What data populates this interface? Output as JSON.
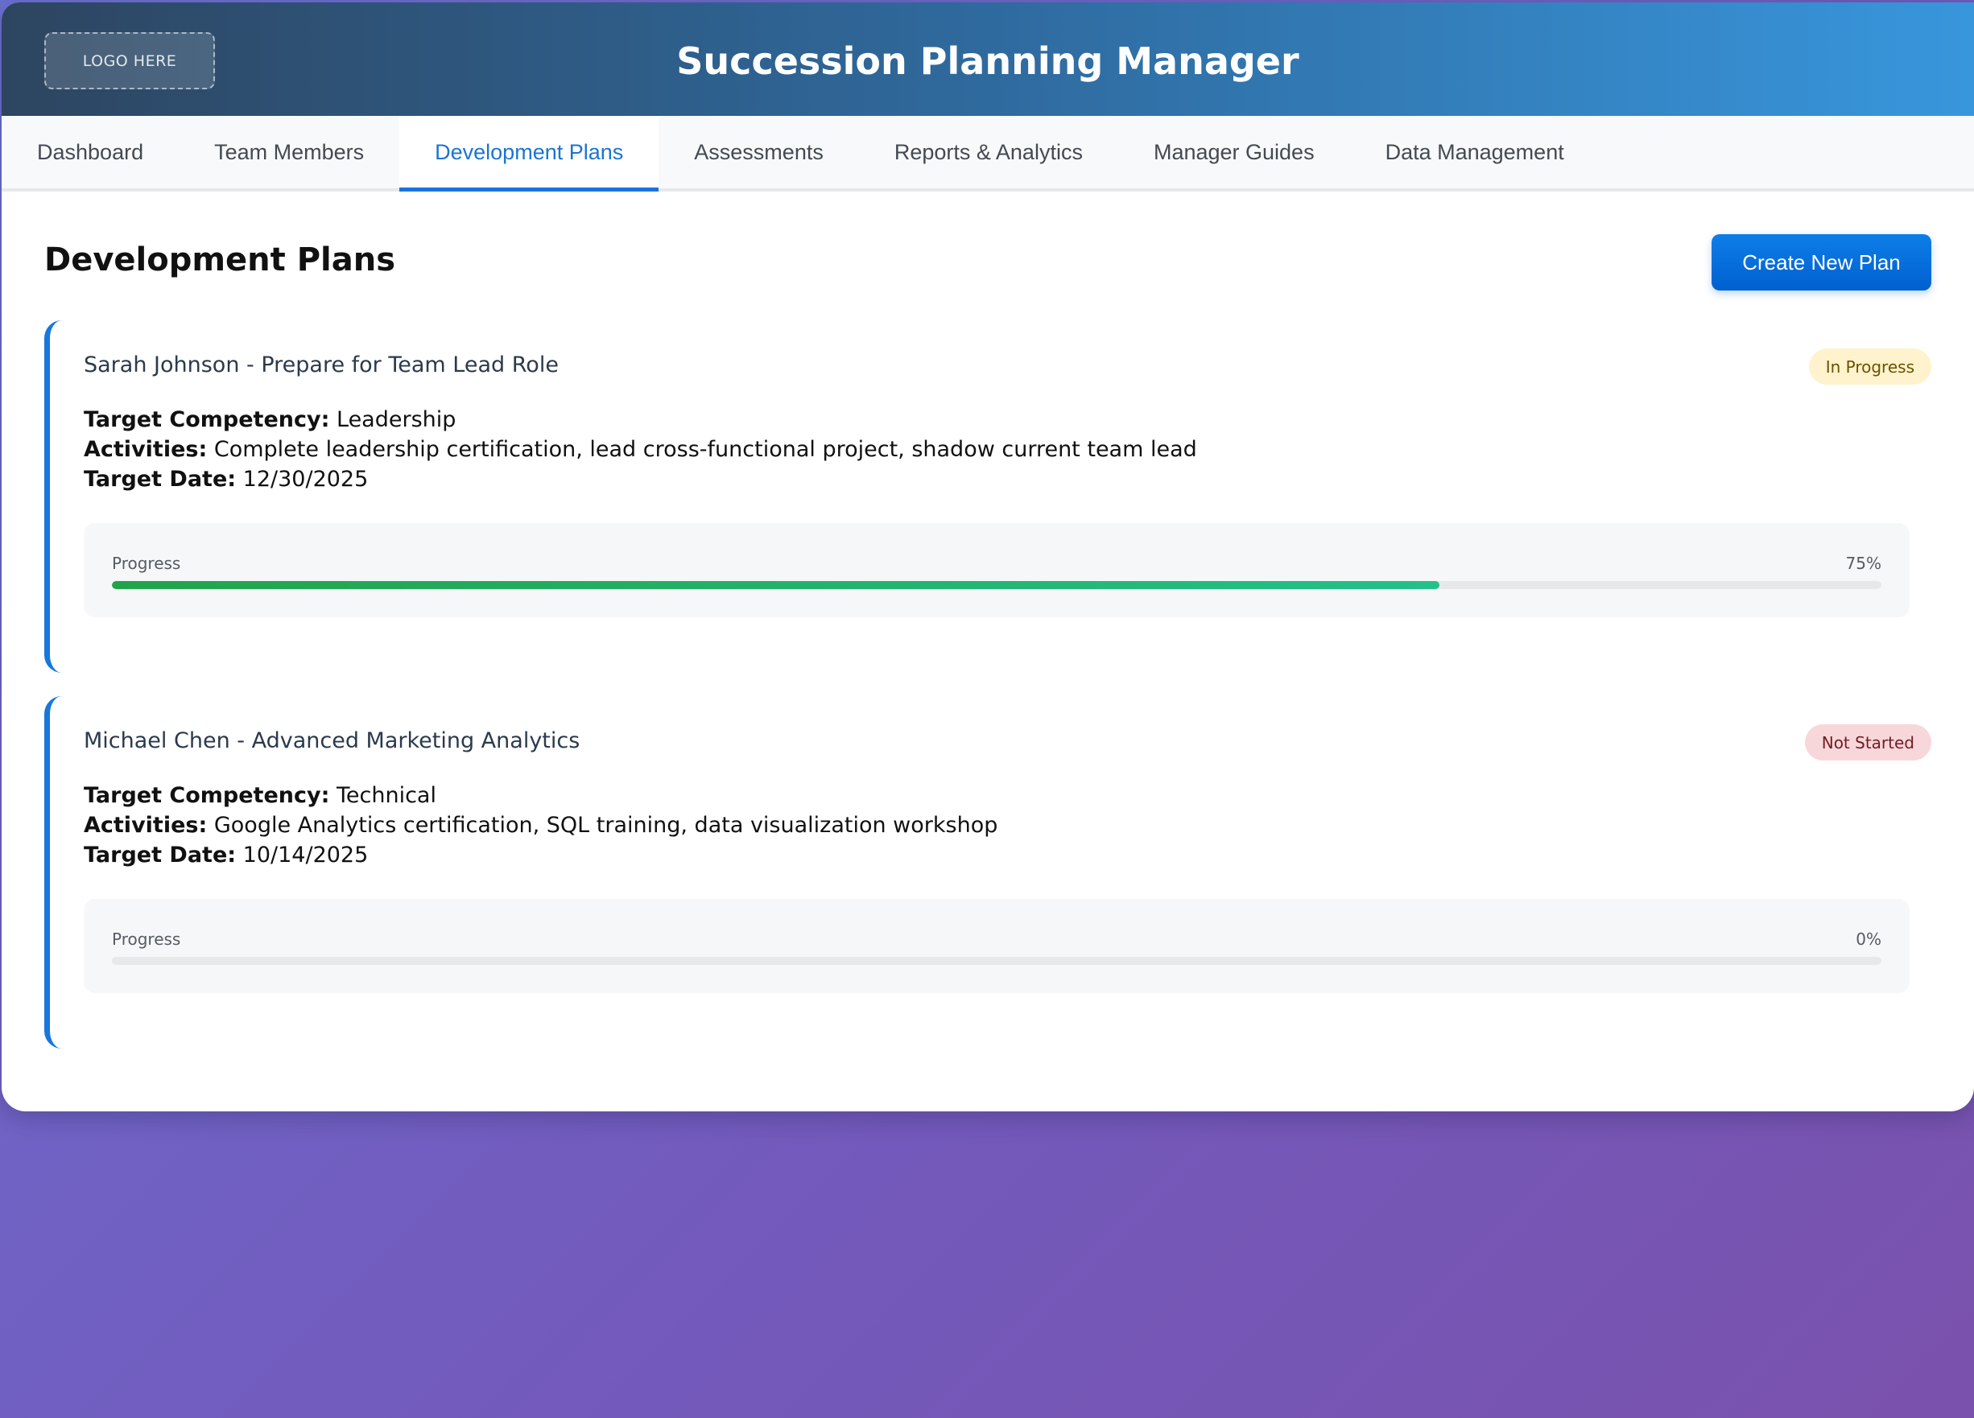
{
  "header": {
    "logo_text": "LOGO HERE",
    "title": "Succession Planning Manager"
  },
  "nav": {
    "tabs": [
      {
        "label": "Dashboard",
        "active": false
      },
      {
        "label": "Team Members",
        "active": false
      },
      {
        "label": "Development Plans",
        "active": true
      },
      {
        "label": "Assessments",
        "active": false
      },
      {
        "label": "Reports & Analytics",
        "active": false
      },
      {
        "label": "Manager Guides",
        "active": false
      },
      {
        "label": "Data Management",
        "active": false
      }
    ]
  },
  "main": {
    "title": "Development Plans",
    "create_button": "Create New Plan",
    "plans": [
      {
        "title": "Sarah Johnson - Prepare for Team Lead Role",
        "status": "In Progress",
        "competency_label": "Target Competency:",
        "competency": "Leadership",
        "activities_label": "Activities:",
        "activities": "Complete leadership certification, lead cross-functional project, shadow current team lead",
        "date_label": "Target Date:",
        "date": "12/30/2025",
        "progress_label": "Progress",
        "progress_text": "75%",
        "progress_value": 75
      },
      {
        "title": "Michael Chen - Advanced Marketing Analytics",
        "status": "Not Started",
        "competency_label": "Target Competency:",
        "competency": "Technical",
        "activities_label": "Activities:",
        "activities": "Google Analytics certification, SQL training, data visualization workshop",
        "date_label": "Target Date:",
        "date": "10/14/2025",
        "progress_label": "Progress",
        "progress_text": "0%",
        "progress_value": 0
      }
    ]
  },
  "colors": {
    "accent": "#1a73dc",
    "in_progress_badge": "#fff3cd",
    "not_started_badge": "#f8d7da",
    "progress_fill": "#22a34a"
  }
}
